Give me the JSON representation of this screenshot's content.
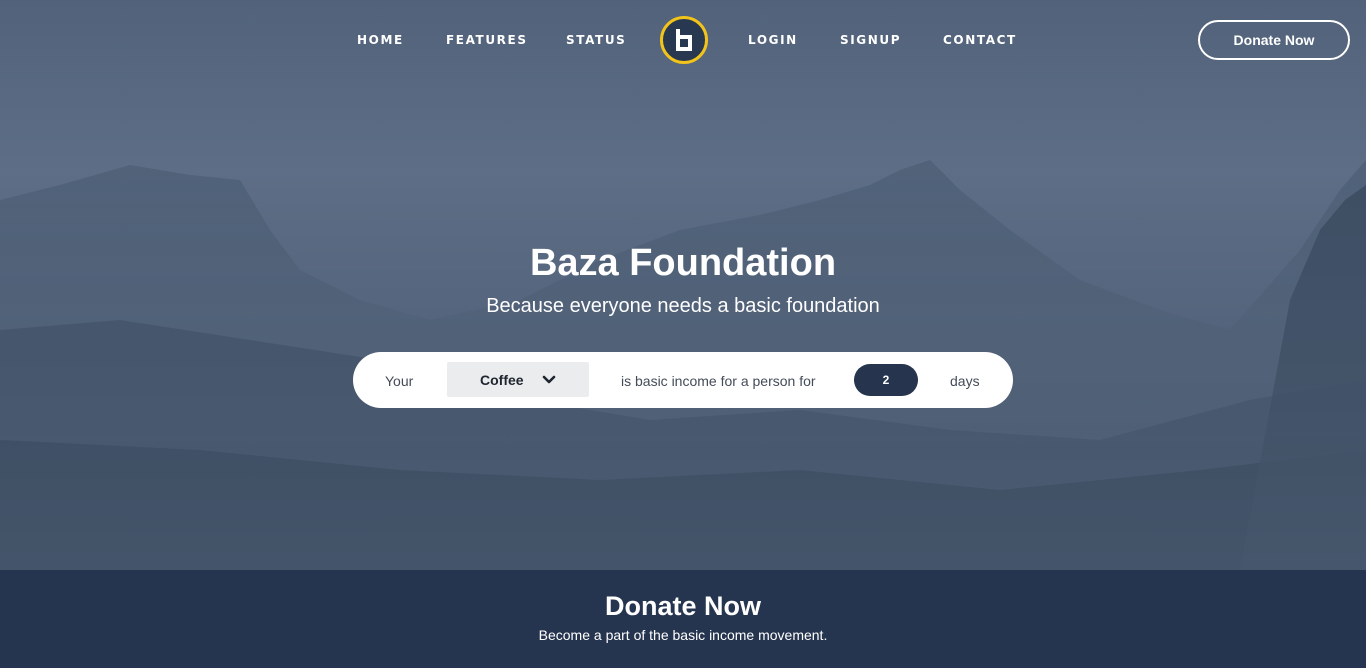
{
  "nav": {
    "items_left": [
      "HOME",
      "FEATURES",
      "STATUS"
    ],
    "items_right": [
      "LOGIN",
      "SIGNUP",
      "CONTACT"
    ],
    "logo_letter": "b",
    "donate_label": "Donate Now"
  },
  "hero": {
    "title": "Baza Foundation",
    "subtitle": "Because everyone needs a basic foundation"
  },
  "calculator": {
    "prefix": "Your",
    "selected_item": "Coffee",
    "middle_text": "is basic income for a person for",
    "days_value": "2",
    "suffix": "days"
  },
  "donate_section": {
    "heading": "Donate Now",
    "text": "Become a part of the basic income movement."
  },
  "colors": {
    "accent": "#f2c31b",
    "navy": "#26354f",
    "white": "#ffffff"
  },
  "icons": {
    "logo": "b-logo-icon",
    "dropdown": "chevron-down-icon"
  }
}
